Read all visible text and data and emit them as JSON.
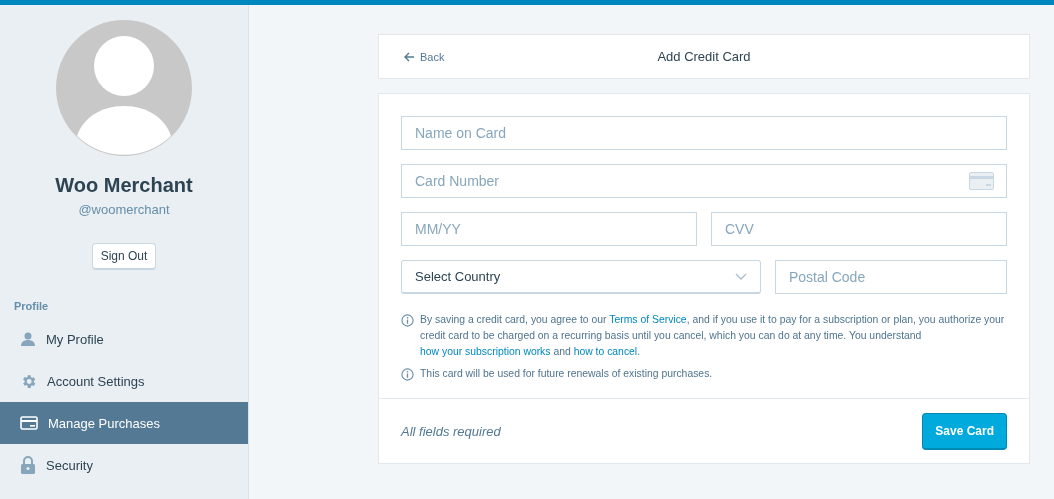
{
  "profile": {
    "name": "Woo Merchant",
    "handle": "@woomerchant",
    "sign_out": "Sign Out"
  },
  "sidebar": {
    "heading": "Profile",
    "items": [
      {
        "label": "My Profile",
        "selected": false
      },
      {
        "label": "Account Settings",
        "selected": false
      },
      {
        "label": "Manage Purchases",
        "selected": true
      },
      {
        "label": "Security",
        "selected": false
      }
    ]
  },
  "header": {
    "back": "Back",
    "title": "Add Credit Card"
  },
  "form": {
    "rows": [
      [
        {
          "kind": "input",
          "placeholder": "Name on Card"
        }
      ],
      [
        {
          "kind": "card-input",
          "placeholder": "Card Number"
        }
      ],
      [
        {
          "kind": "input",
          "placeholder": "MM/YY"
        },
        {
          "kind": "input",
          "placeholder": "CVV"
        }
      ],
      [
        {
          "kind": "select",
          "value": "Select Country"
        },
        {
          "kind": "input",
          "placeholder": "Postal Code"
        }
      ]
    ],
    "notices": [
      {
        "segments": [
          {
            "kind": "text",
            "text": "By saving a credit card, you agree to our "
          },
          {
            "kind": "link",
            "text": "Terms of Service"
          },
          {
            "kind": "text",
            "text": ", and if you use it to pay for a subscription or plan, you authorize your credit card to be charged on a recurring basis until you cancel, which you can do at any time. You understand "
          },
          {
            "kind": "link",
            "text": "how your subscription works"
          },
          {
            "kind": "text",
            "text": " and "
          },
          {
            "kind": "link",
            "text": "how to cancel"
          },
          {
            "kind": "text",
            "text": "."
          }
        ]
      },
      {
        "segments": [
          {
            "kind": "text",
            "text": "This card will be used for future renewals of existing purchases."
          }
        ]
      }
    ]
  },
  "footer": {
    "note": "All fields required",
    "button": "Save Card"
  }
}
